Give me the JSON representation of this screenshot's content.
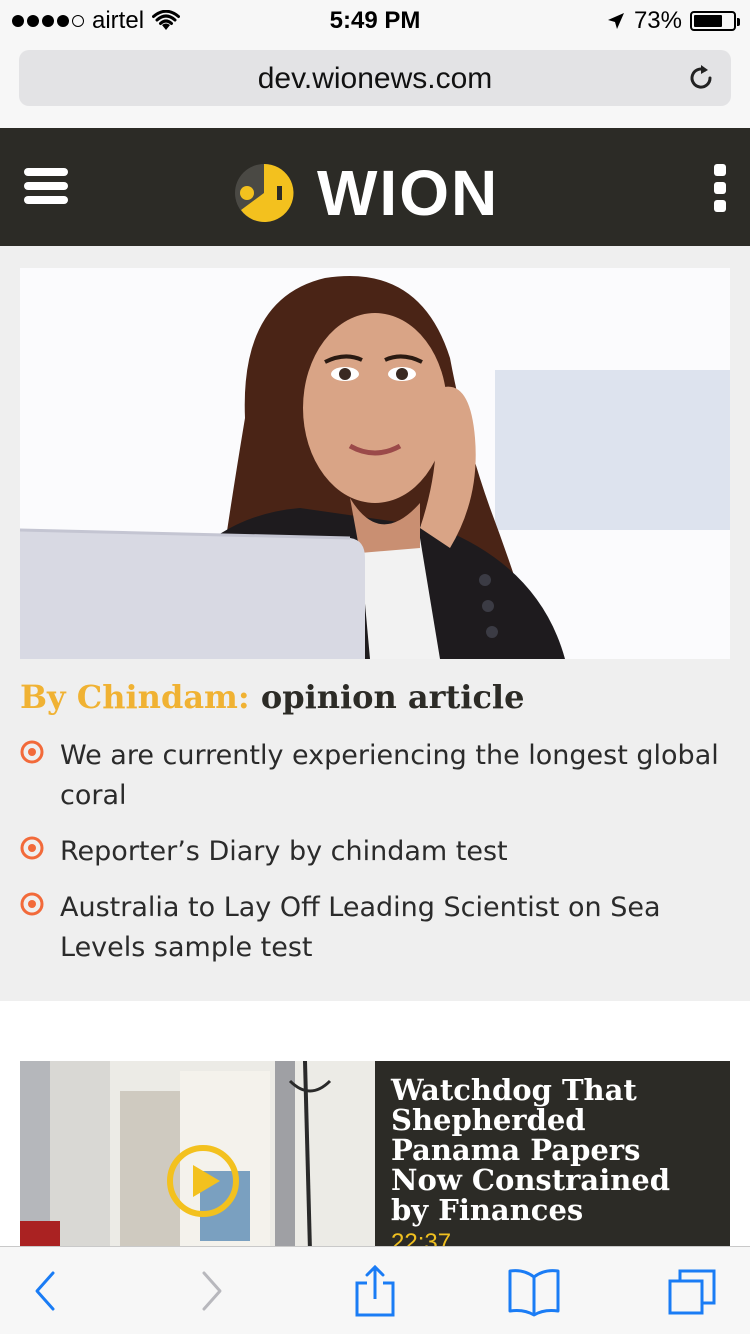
{
  "status_bar": {
    "carrier": "airtel",
    "time": "5:49 PM",
    "battery": "73%",
    "battery_level": 0.73,
    "signal_bars": 4
  },
  "browser": {
    "url": "dev.wionews.com"
  },
  "header": {
    "logo_text": "WION"
  },
  "article": {
    "byline": "By Chindam:",
    "title": "opinion article",
    "related": [
      "We are currently experiencing the longest global coral",
      "Reporter’s Diary by chindam test",
      "Australia to Lay Off Leading Scientist on Sea Levels sample test"
    ]
  },
  "video": {
    "title": "Watchdog That Shepherded Panama Papers Now Constrained by Finances",
    "duration": "22:37"
  },
  "colors": {
    "header_bg": "#2c2b26",
    "accent_yellow": "#f0b233",
    "bullet_orange": "#f26a3a",
    "ios_blue": "#1a7cf5"
  }
}
